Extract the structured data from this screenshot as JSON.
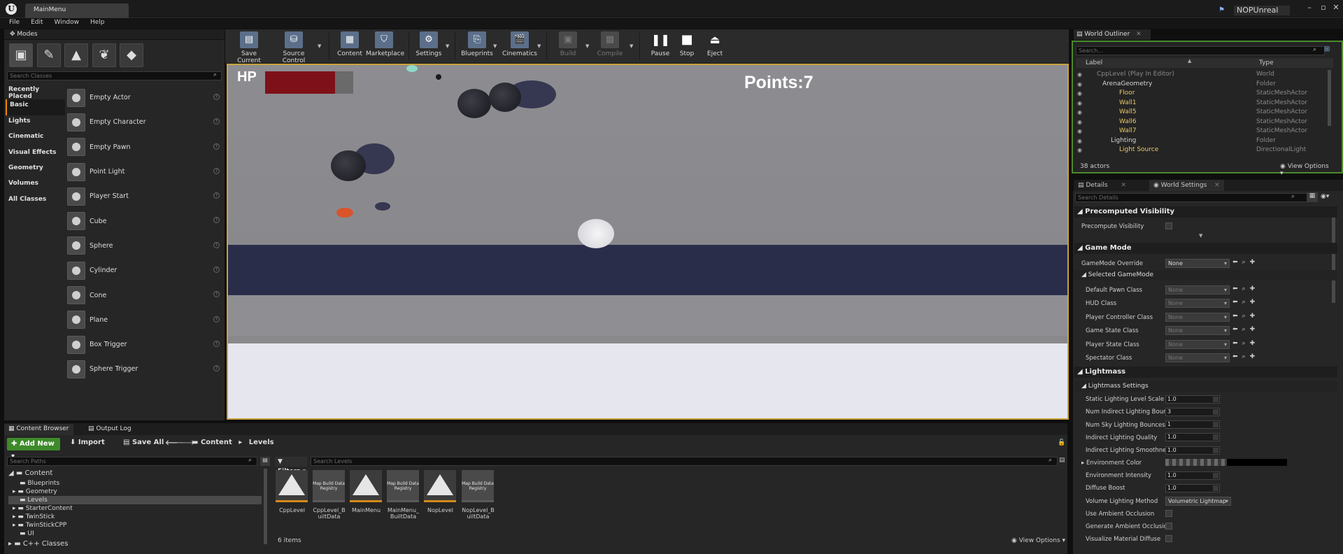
{
  "window": {
    "tab_title": "MainMenu",
    "project_name": "NOPUnreal",
    "logo": "U"
  },
  "menu": [
    "File",
    "Edit",
    "Window",
    "Help"
  ],
  "modes": {
    "tab_label": "Modes",
    "search_placeholder": "Search Classes",
    "categories": [
      "Recently Placed",
      "Basic",
      "Lights",
      "Cinematic",
      "Visual Effects",
      "Geometry",
      "Volumes",
      "All Classes"
    ],
    "active_category": "Basic",
    "classes": [
      "Empty Actor",
      "Empty Character",
      "Empty Pawn",
      "Point Light",
      "Player Start",
      "Cube",
      "Sphere",
      "Cylinder",
      "Cone",
      "Plane",
      "Box Trigger",
      "Sphere Trigger"
    ]
  },
  "toolbar": {
    "save_current": "Save Current",
    "source_control": "Source Control",
    "content": "Content",
    "marketplace": "Marketplace",
    "settings": "Settings",
    "blueprints": "Blueprints",
    "cinematics": "Cinematics",
    "build": "Build",
    "compile": "Compile",
    "pause": "Pause",
    "stop": "Stop",
    "eject": "Eject"
  },
  "game": {
    "hp_label": "HP",
    "hp_fraction": 0.79,
    "points_text": "Points:7"
  },
  "outliner": {
    "tab_label": "World Outliner",
    "search_placeholder": "Search...",
    "col_label": "Label",
    "col_type": "Type",
    "rows": [
      {
        "label": "CppLevel (Play In Editor)",
        "type": "World"
      },
      {
        "label": "ArenaGeometry",
        "type": "Folder"
      },
      {
        "label": "Floor",
        "type": "StaticMeshActor"
      },
      {
        "label": "Wall1",
        "type": "StaticMeshActor"
      },
      {
        "label": "Wall5",
        "type": "StaticMeshActor"
      },
      {
        "label": "Wall6",
        "type": "StaticMeshActor"
      },
      {
        "label": "Wall7",
        "type": "StaticMeshActor"
      },
      {
        "label": "Lighting",
        "type": "Folder"
      },
      {
        "label": "Light Source",
        "type": "DirectionalLight"
      }
    ],
    "count": "38 actors",
    "view_options": "View Options"
  },
  "details": {
    "tab_details": "Details",
    "tab_world_settings": "World Settings",
    "search_placeholder": "Search Details",
    "precomputed_visibility": "Precomputed Visibility",
    "precompute_visibility": "Precompute Visibility",
    "game_mode": "Game Mode",
    "gamemode_override": "GameMode Override",
    "gamemode_override_value": "None",
    "selected_gamemode": "Selected GameMode",
    "class_props": [
      {
        "label": "Default Pawn Class",
        "value": "None"
      },
      {
        "label": "HUD Class",
        "value": "None"
      },
      {
        "label": "Player Controller Class",
        "value": "None"
      },
      {
        "label": "Game State Class",
        "value": "None"
      },
      {
        "label": "Player State Class",
        "value": "None"
      },
      {
        "label": "Spectator Class",
        "value": "None"
      }
    ],
    "lightmass": "Lightmass",
    "lightmass_settings": "Lightmass Settings",
    "light_props": [
      {
        "label": "Static Lighting Level Scale",
        "value": "1.0"
      },
      {
        "label": "Num Indirect Lighting Bounces",
        "value": "3"
      },
      {
        "label": "Num Sky Lighting Bounces",
        "value": "1"
      },
      {
        "label": "Indirect Lighting Quality",
        "value": "1.0"
      },
      {
        "label": "Indirect Lighting Smoothness",
        "value": "1.0"
      }
    ],
    "environment_color": "Environment Color",
    "environment_intensity": "Environment Intensity",
    "environment_intensity_value": "1.0",
    "diffuse_boost": "Diffuse Boost",
    "diffuse_boost_value": "1.0",
    "volume_lighting_method": "Volume Lighting Method",
    "volume_lighting_method_value": "Volumetric Lightmap",
    "use_ambient_occlusion": "Use Ambient Occlusion",
    "generate_ambient_occlusion": "Generate Ambient Occlusion",
    "visualize_material_diffuse": "Visualize Material Diffuse"
  },
  "content_browser": {
    "tab_content_browser": "Content Browser",
    "tab_output_log": "Output Log",
    "add_new": "Add New",
    "import": "Import",
    "save_all": "Save All",
    "path_content": "Content",
    "path_levels": "Levels",
    "search_paths": "Search Paths",
    "filters": "Filters",
    "search_levels": "Search Levels",
    "tree": {
      "root": "Content",
      "items": [
        "Blueprints",
        "Geometry",
        "Levels",
        "StarterContent",
        "TwinStick",
        "TwinStickCPP",
        "UI"
      ],
      "cpp": "C++ Classes"
    },
    "assets": [
      {
        "name": "CppLevel",
        "kind": "level"
      },
      {
        "name": "CppLevel_BuiltData",
        "kind": "registry",
        "thumb": "Map Build Data Registry"
      },
      {
        "name": "MainMenu",
        "kind": "level"
      },
      {
        "name": "MainMenu_BuiltData",
        "kind": "registry",
        "thumb": "Map Build Data Registry"
      },
      {
        "name": "NopLevel",
        "kind": "level"
      },
      {
        "name": "NopLevel_BuiltData",
        "kind": "registry",
        "thumb": "Map Build Data Registry"
      }
    ],
    "item_count": "6 items",
    "view_options": "View Options"
  },
  "colors": {
    "accent": "#d38a1a",
    "add_new": "#3d8a2a",
    "hp_fill": "#7e1019",
    "outliner_border": "#4b8a2c"
  }
}
